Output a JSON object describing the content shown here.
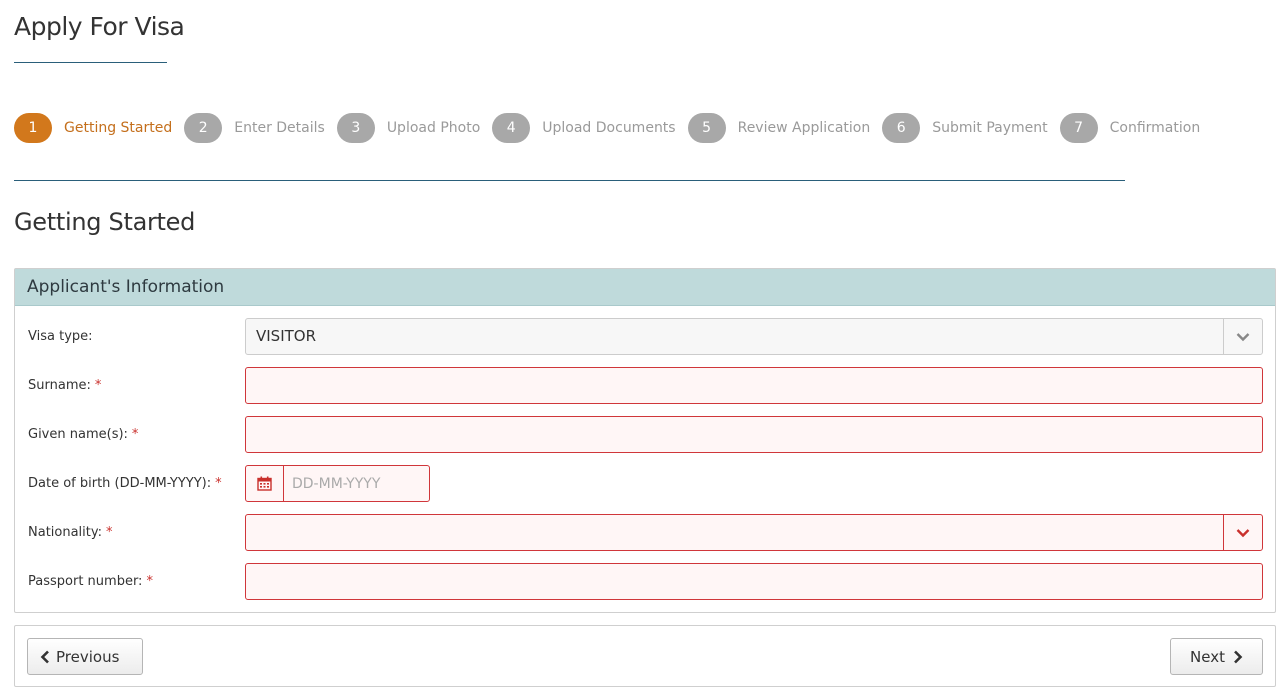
{
  "page": {
    "title": "Apply For Visa"
  },
  "steps": [
    {
      "num": "1",
      "label": "Getting Started",
      "active": true
    },
    {
      "num": "2",
      "label": "Enter Details"
    },
    {
      "num": "3",
      "label": "Upload Photo"
    },
    {
      "num": "4",
      "label": "Upload Documents"
    },
    {
      "num": "5",
      "label": "Review Application"
    },
    {
      "num": "6",
      "label": "Submit Payment"
    },
    {
      "num": "7",
      "label": "Confirmation"
    }
  ],
  "section": {
    "title": "Getting Started"
  },
  "panel": {
    "title": "Applicant's Information",
    "fields": {
      "visa_type": {
        "label": "Visa type:",
        "value": "VISITOR"
      },
      "surname": {
        "label": "Surname:",
        "required": "*",
        "value": ""
      },
      "given_names": {
        "label": "Given name(s):",
        "required": "*",
        "value": ""
      },
      "dob": {
        "label": "Date of birth (DD-MM-YYYY):",
        "required": "*",
        "placeholder": "DD-MM-YYYY",
        "value": ""
      },
      "nationality": {
        "label": "Nationality:",
        "required": "*",
        "value": ""
      },
      "passport": {
        "label": "Passport number:",
        "required": "*",
        "value": ""
      }
    }
  },
  "footer": {
    "previous_label": "Previous",
    "next_label": "Next"
  },
  "colors": {
    "accent": "#d2781c",
    "error": "#d0363a",
    "panel_head": "#bfdadb",
    "rule": "#2a5f7a"
  }
}
